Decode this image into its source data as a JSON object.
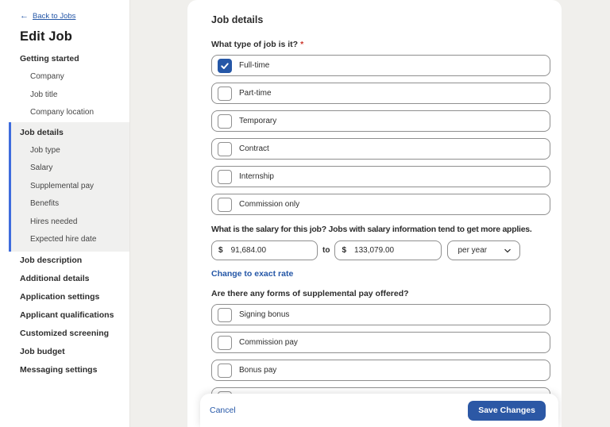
{
  "colors": {
    "accent_blue": "#2557a7",
    "active_indicator_blue": "#3e6cdd",
    "save_button_blue": "#2c58a5",
    "required_red": "#cc372c",
    "page_background": "#f0efec",
    "border_gray": "#8f8f8f"
  },
  "sidebar": {
    "back_icon": "←",
    "back_label": "Back to Jobs",
    "title": "Edit Job",
    "sections": [
      {
        "label": "Getting started",
        "active": false,
        "children": [
          "Company",
          "Job title",
          "Company location"
        ]
      },
      {
        "label": "Job details",
        "active": true,
        "children": [
          "Job type",
          "Salary",
          "Supplemental pay",
          "Benefits",
          "Hires needed",
          "Expected hire date"
        ]
      },
      {
        "label": "Job description",
        "active": false,
        "children": []
      },
      {
        "label": "Additional details",
        "active": false,
        "children": []
      },
      {
        "label": "Application settings",
        "active": false,
        "children": []
      },
      {
        "label": "Applicant qualifications",
        "active": false,
        "children": []
      },
      {
        "label": "Customized screening",
        "active": false,
        "children": []
      },
      {
        "label": "Job budget",
        "active": false,
        "children": []
      },
      {
        "label": "Messaging settings",
        "active": false,
        "children": []
      }
    ]
  },
  "main": {
    "title": "Job details",
    "job_type_question": {
      "label": "What type of job is it?",
      "required_mark": "*",
      "options": [
        {
          "label": "Full-time",
          "checked": true
        },
        {
          "label": "Part-time",
          "checked": false
        },
        {
          "label": "Temporary",
          "checked": false
        },
        {
          "label": "Contract",
          "checked": false
        },
        {
          "label": "Internship",
          "checked": false
        },
        {
          "label": "Commission only",
          "checked": false
        }
      ]
    },
    "salary_question": {
      "label": "What is the salary for this job? Jobs with salary information tend to get more applies.",
      "currency_symbol": "$",
      "min_value": "91,684.00",
      "to_label": "to",
      "max_value": "133,079.00",
      "rate_value": "per year"
    },
    "exact_rate_link": "Change to exact rate",
    "supplemental_question": {
      "label": "Are there any forms of supplemental pay offered?",
      "options": [
        {
          "label": "Signing bonus",
          "checked": false
        },
        {
          "label": "Commission pay",
          "checked": false
        },
        {
          "label": "Bonus pay",
          "checked": false
        }
      ]
    }
  },
  "footer": {
    "cancel_label": "Cancel",
    "save_label": "Save Changes"
  }
}
